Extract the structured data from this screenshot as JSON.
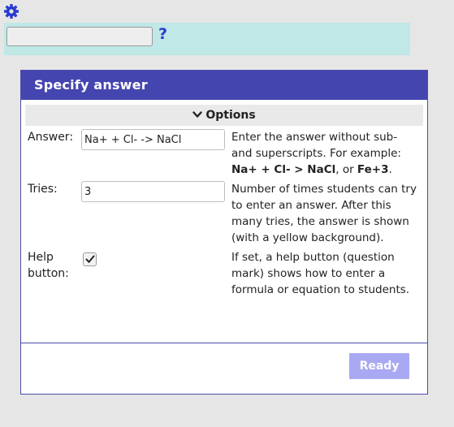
{
  "toolbar": {
    "settings_icon": "gear-icon",
    "input_value": "",
    "help_label": "?",
    "background": "#bfe8e6"
  },
  "dialog": {
    "title": "Specify answer",
    "options_label": "Options",
    "answer": {
      "label": "Answer:",
      "value": "Na+ + Cl- -> NaCl",
      "desc_prefix": "Enter the answer without sub- and superscripts. For example: ",
      "desc_example1": "Na+ + Cl- > NaCl",
      "desc_mid": ", or ",
      "desc_example2": "Fe+3",
      "desc_suffix": "."
    },
    "tries": {
      "label": "Tries:",
      "value": "3",
      "desc": "Number of times students can try to enter an answer. After this many tries, the answer is shown (with a yellow background)."
    },
    "help_button": {
      "label": "Help button:",
      "checked": true,
      "desc": "If set, a help button (question mark) shows how to enter a formula or equation to students."
    },
    "ready_label": "Ready",
    "header_color": "#4545b0",
    "ready_color": "#a9a9f3"
  }
}
